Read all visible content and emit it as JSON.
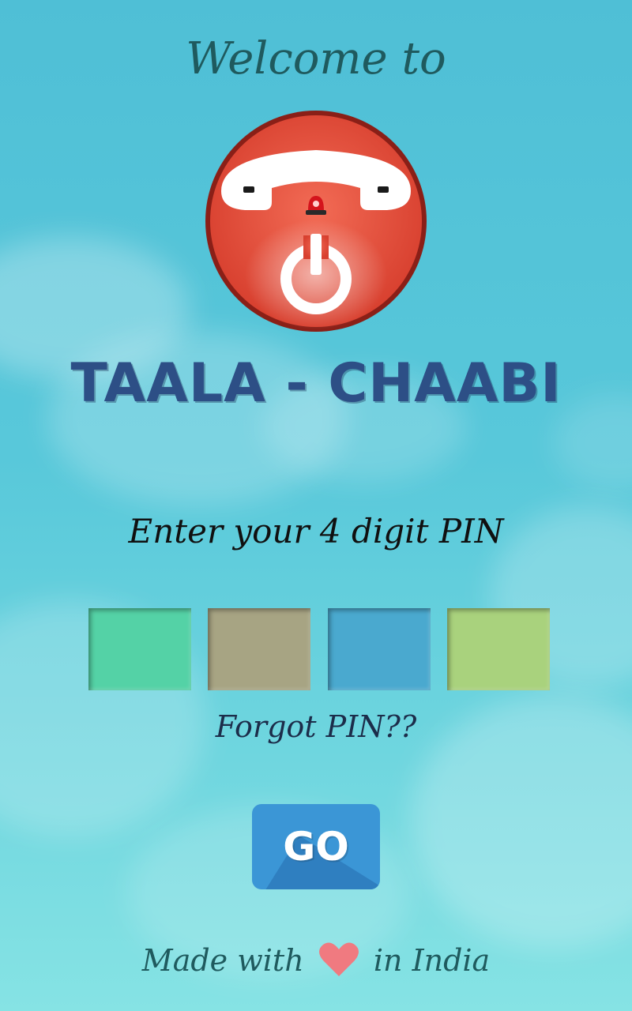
{
  "header": {
    "welcome_text": "Welcome to"
  },
  "app": {
    "title": "TAALA - CHAABI"
  },
  "pin": {
    "prompt": "Enter your 4 digit PIN",
    "box_colors": [
      "#54d2a6",
      "#a7a483",
      "#4aa9cf",
      "#a9d27d"
    ],
    "forgot_link": "Forgot PIN??"
  },
  "actions": {
    "go_label": "GO"
  },
  "footer": {
    "made_with": "Made with",
    "in_india": "in India",
    "heart_icon": "heart-icon",
    "heart_color": "#f07a80"
  },
  "colors": {
    "logo_red": "#e8503e",
    "background": "#58c8da",
    "go_blue": "#3b96d6"
  }
}
